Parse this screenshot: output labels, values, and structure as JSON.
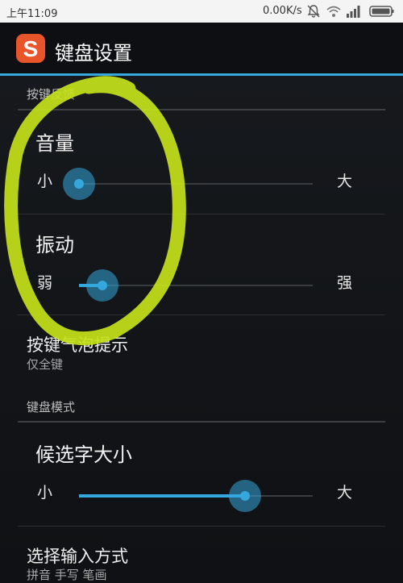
{
  "status_bar": {
    "time": "上午11:09",
    "net_speed": "0.00K/s",
    "icons": [
      "bell-muted-icon",
      "wifi-icon",
      "signal-icon",
      "battery-icon"
    ]
  },
  "action_bar": {
    "logo": "sogou-s-logo",
    "logo_letter": "S",
    "title": "键盘设置",
    "accent_color": "#34a8dc"
  },
  "sections": {
    "key_feedback": {
      "header": "按键反馈",
      "volume": {
        "title": "音量",
        "min_label": "小",
        "max_label": "大",
        "level": 0.0
      },
      "vibration": {
        "title": "振动",
        "min_label": "弱",
        "max_label": "强",
        "level": 0.1
      },
      "bubble_hint": {
        "title": "按键气泡提示",
        "summary": "仅全键"
      }
    },
    "keyboard_mode": {
      "header": "键盘模式",
      "candidate_size": {
        "title": "候选字大小",
        "min_label": "小",
        "max_label": "大",
        "level": 0.71
      },
      "input_method": {
        "title": "选择输入方式",
        "summary": "拼音 手写 笔画"
      }
    }
  },
  "annotation": {
    "color": "#c6e21a",
    "shape": "hand-drawn-circle"
  }
}
